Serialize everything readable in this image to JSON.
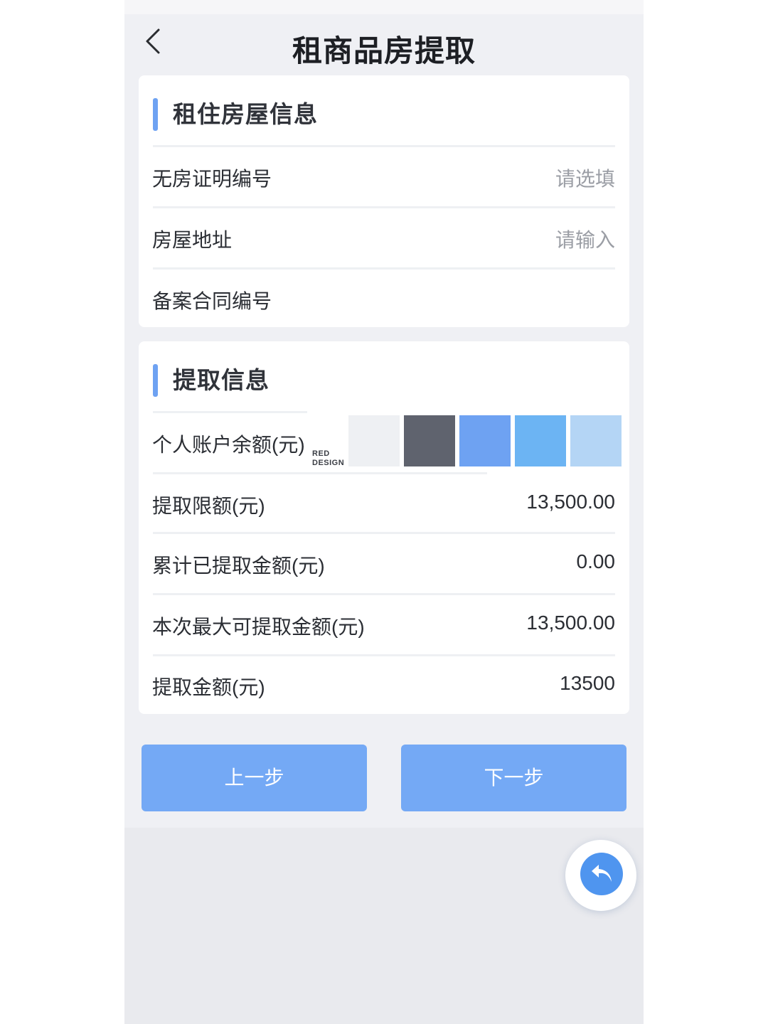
{
  "header": {
    "title": "租商品房提取",
    "back_icon": "chevron-left-icon"
  },
  "rental_section": {
    "title": "租住房屋信息",
    "rows": [
      {
        "label": "无房证明编号",
        "value": "请选填",
        "is_placeholder": true
      },
      {
        "label": "房屋地址",
        "value": "请输入",
        "is_placeholder": true
      },
      {
        "label": "备案合同编号",
        "value": ""
      }
    ]
  },
  "withdraw_section": {
    "title": "提取信息",
    "rows": [
      {
        "label": "个人账户余额(元)",
        "value": ""
      },
      {
        "label": "提取限额(元)",
        "value": "13,500.00"
      },
      {
        "label": "累计已提取金额(元)",
        "value": "0.00"
      },
      {
        "label": "本次最大可提取金额(元)",
        "value": "13,500.00"
      },
      {
        "label": "提取金额(元)",
        "value": "13500"
      }
    ]
  },
  "palette": {
    "brand_line1": "RED",
    "brand_line2": "DESIGN",
    "colors": [
      "#eef0f3",
      "#5f636e",
      "#6ea2f2",
      "#6cb4f3",
      "#b4d5f5"
    ]
  },
  "buttons": {
    "prev_label": "上一步",
    "next_label": "下一步"
  },
  "fab": {
    "icon": "reply-icon"
  },
  "colors": {
    "accent": "#6ea2f2",
    "button": "#74a9f5",
    "fab": "#4f95ef",
    "background": "#eff0f4"
  }
}
